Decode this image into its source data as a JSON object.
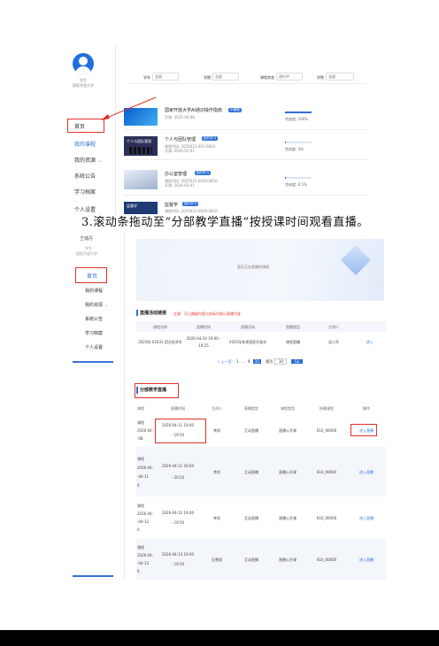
{
  "shot1": {
    "user_name": "学生",
    "user_school": "国家开放大学",
    "nav": [
      "首页",
      "我的课程",
      "我的资源",
      "系统公告",
      "学习档案",
      "个人设置"
    ],
    "filters": [
      {
        "label": "学年",
        "value": "全部"
      },
      {
        "label": "学期",
        "value": "全部"
      },
      {
        "label": "课程状态",
        "value": "进行中"
      },
      {
        "label": "学院",
        "value": "全部"
      }
    ],
    "courses": [
      {
        "title": "国家开放大学AI通识操作指南",
        "tag": "AI课程",
        "meta1": "开课: 2025-04-08",
        "meta2": "",
        "progress_label": "完成度: 100%",
        "progress": 1.0,
        "thumb": "",
        "thumb_color": "#1e88e5"
      },
      {
        "title": "个人与团队管理",
        "tag": "国开学习",
        "meta1": "课程代码: 2025021-001-0810",
        "meta2": "开课: 2026-02-01",
        "progress_label": "完成度: 3%",
        "progress": 0.03,
        "thumb": "个人与团队管理",
        "thumb_color": "#2c2f5a"
      },
      {
        "title": "办公室管理",
        "tag": "国开学习",
        "meta1": "课程代码: 2025021-0024-0810",
        "meta2": "开课: 2026-02-01",
        "progress_label": "完成度: 0.5%",
        "progress": 0.005,
        "thumb": "",
        "thumb_color": "#cfd7e6"
      },
      {
        "title": "监督学",
        "tag": "国开学习",
        "meta1": "课程代码: 2025021-0029-0810",
        "meta2": "",
        "progress_label": "",
        "progress": 0,
        "thumb": "监督学",
        "thumb_color": "#1f3b73"
      }
    ]
  },
  "instruction": "3.滚动条拖动至“分部教学直播”按授课时间观看直播。",
  "shot2": {
    "user_name": "王瑞丹",
    "user_role": "学生",
    "user_school": "国家开放大学",
    "nav": [
      "首页",
      "我的课程",
      "我的资源",
      "系统公告",
      "学习档案",
      "个人设置"
    ],
    "banner_text": "暂无正在直播的课程",
    "live_section": {
      "title": "直播活动链接",
      "note": "注意：可上播放内容与实际内容以直播为准",
      "headers": [
        "课程名称",
        "直播时间",
        "直播活动",
        "直播类型",
        "主讲人",
        ""
      ],
      "row": {
        "course": "2025秋-02031 西方经济学",
        "time1": "2026-04-10 19:00 -",
        "time2": "19:25",
        "activity": "2025年秋季国家开放学",
        "type": "课程直播",
        "teacher": "吴小军",
        "action": "进入"
      }
    },
    "pagination": {
      "prev": "« 上一页",
      "pages": [
        "1",
        "...",
        "9",
        "10"
      ],
      "current": "10",
      "goto_label": "第页",
      "goto_value": "10",
      "go_button": "Go"
    },
    "branch": {
      "title": "分部教学直播",
      "headers": [
        "课程",
        "直播时间",
        "主讲人",
        "直播类型",
        "课程类型",
        "所属课程",
        "操作"
      ],
      "rows": [
        {
          "course": [
            "课程",
            "2026-04-",
            "-08"
          ],
          "time1": "2026-04-11 19:00",
          "time2": "- 19:50",
          "teacher": "李欣",
          "type": "互动直播",
          "ctype": "直播公开课",
          "code": "610_00000",
          "action": "进入直播"
        },
        {
          "course": [
            "课程",
            "2026-04-",
            "-04-11",
            "0"
          ],
          "time1": "2026-04-11 20:00",
          "time2": "- 20:50",
          "teacher": "李欣",
          "type": "互动直播",
          "ctype": "直播公开课",
          "code": "610_00000",
          "action": "进入直播"
        },
        {
          "course": [
            "课程",
            "2026-04-",
            "-04-12",
            "0"
          ],
          "time1": "2026-04-12 19:00",
          "time2": "- 19:50",
          "teacher": "李欣",
          "type": "互动直播",
          "ctype": "直播公开课",
          "code": "610_00000",
          "action": "进入直播"
        },
        {
          "course": [
            "课程",
            "2026-04-",
            "-04-13",
            "0"
          ],
          "time1": "2026-04-13 19:00",
          "time2": "- 19:50",
          "teacher": "石雪丽",
          "type": "互动直播",
          "ctype": "直播公开课",
          "code": "610_00000",
          "action": "进入直播"
        }
      ]
    }
  }
}
